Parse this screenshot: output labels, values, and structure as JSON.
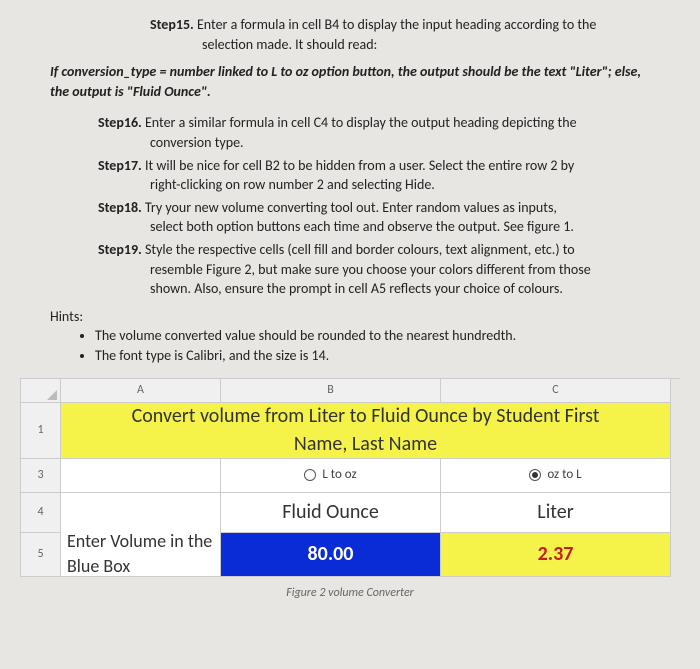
{
  "step15": {
    "label": "Step15.",
    "text1": "Enter a formula in cell B4 to display the input heading according to the",
    "text2": "selection made. It should read:"
  },
  "italicLine": "If conversion_type = number linked to L to oz option button, the output should be the text \"Liter\"; else, the output is \"Fluid Ounce\".",
  "step16": {
    "label": "Step16.",
    "text1": "Enter a similar formula in cell C4 to display the output heading depicting the",
    "text2": "conversion type."
  },
  "step17": {
    "label": "Step17.",
    "text1": "It will be nice for cell B2 to be hidden from a user. Select the entire row 2 by",
    "text2": "right-clicking on row number 2 and selecting Hide."
  },
  "step18": {
    "label": "Step18.",
    "text1": "Try your new volume converting tool out. Enter random values as inputs,",
    "text2": "select both option buttons each time and observe the output. See figure 1."
  },
  "step19": {
    "label": "Step19.",
    "text1": "Style the respective cells (cell fill and border colours, text alignment, etc.) to",
    "text2": "resemble Figure 2, but make sure you choose your colors different from those",
    "text3": "shown. Also, ensure the prompt in cell A5 reflects your choice of colours."
  },
  "hints": {
    "label": "Hints:",
    "h1": "The volume converted value should be rounded to the nearest hundredth.",
    "h2": "The font type is Calibri, and the size is 14."
  },
  "sheet": {
    "cols": {
      "A": "A",
      "B": "B",
      "C": "C"
    },
    "rows": {
      "r1": "1",
      "r3": "3",
      "r4": "4",
      "r5": "5"
    },
    "title_l1": "Convert volume from Liter to Fluid Ounce by Student First",
    "title_l2": "Name, Last Name",
    "optB": "L to oz",
    "optC": "oz to L",
    "hdrB": "Fluid Ounce",
    "hdrC": "Liter",
    "labelA": "Enter Volume in the Blue Box",
    "valB": "80.00",
    "valC": "2.37"
  },
  "caption": "Figure 2 volume Converter"
}
